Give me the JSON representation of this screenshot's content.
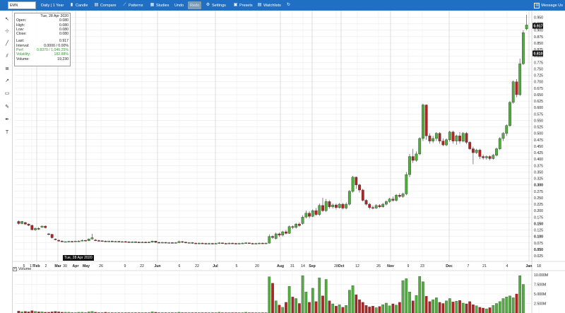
{
  "symbol": "EMN",
  "toolbar": {
    "timeframe": "Daily | 1 Year",
    "candle": "Candle",
    "compare": "Compare",
    "patterns": "Patterns",
    "studies": "Studies",
    "undo": "Undo",
    "redo": "Redo",
    "settings": "Settings",
    "presets": "Presets",
    "watchlists": "Watchlists",
    "message": "Message Us"
  },
  "colors": {
    "toolbar": "#1f6fc4",
    "up": "#4fae3c",
    "down": "#b22323",
    "grid": "#e6e6e6",
    "panel_green": "#2e9d2e"
  },
  "info_panel": {
    "date": "Tue, 28 Apr 2020",
    "open_label": "Open:",
    "open": "0.080",
    "high_label": "High:",
    "high": "0.080",
    "low_label": "Low:",
    "low": "0.080",
    "close_label": "Close:",
    "close": "0.080",
    "last_label": "Last:",
    "last": "0.917",
    "interval_label": "Interval:",
    "interval": "0.0000 / 0.00%",
    "perf_label": "Perf:",
    "perf": "0.8370 / 1,046.25%",
    "volatility_label": "Volatility:",
    "volatility": "182.88%",
    "volume_label": "Volume:",
    "volume": "19,230"
  },
  "cursor_date": "Tue, 28 Apr 2020",
  "volume_panel": {
    "label": "Volume"
  },
  "chart_data": {
    "type": "candlestick",
    "symbol": "EMN",
    "range": "Daily | 1 Year",
    "ylim": [
      0.025,
      0.965
    ],
    "y_ticks": [
      "0.950",
      "0.925",
      "0.900",
      "0.875",
      "0.850",
      "0.825",
      "0.800",
      "0.775",
      "0.750",
      "0.725",
      "0.700",
      "0.675",
      "0.650",
      "0.625",
      "0.600",
      "0.575",
      "0.550",
      "0.525",
      "0.500",
      "0.475",
      "0.450",
      "0.425",
      "0.400",
      "0.375",
      "0.350",
      "0.325",
      "0.300",
      "0.275",
      "0.250",
      "0.225",
      "0.200",
      "0.175",
      "0.150",
      "0.125",
      "0.100",
      "0.075",
      "0.050",
      "0.025"
    ],
    "bold_ticks": [
      "0.300",
      "0.150",
      "0.100",
      "0.050"
    ],
    "price_markers": [
      "0.917",
      "0.810"
    ],
    "x_ticks": [
      "5",
      "17",
      "Feb",
      "2",
      "Mar",
      "30",
      "Apr",
      "May",
      "26",
      "9",
      "22",
      "Jun",
      "6",
      "22",
      "Jul",
      "5",
      "20",
      "Aug",
      "31",
      "14",
      "Sep",
      "28",
      "Oct",
      "12",
      "26",
      "Nov",
      "9",
      "23",
      "Dec",
      "7",
      "21",
      "4",
      "Jan",
      "18"
    ],
    "volume_ticks": [
      "10.000M",
      "7.500M",
      "5.000M",
      "2.500M"
    ],
    "volume_ylim": [
      0,
      10
    ],
    "candles": [
      {
        "o": 0.158,
        "c": 0.15,
        "h": 0.162,
        "l": 0.146
      },
      {
        "o": 0.15,
        "c": 0.158,
        "h": 0.16,
        "l": 0.147
      },
      {
        "o": 0.154,
        "c": 0.148,
        "h": 0.156,
        "l": 0.145
      },
      {
        "o": 0.148,
        "c": 0.143,
        "h": 0.15,
        "l": 0.14
      },
      {
        "o": 0.143,
        "c": 0.126,
        "h": 0.145,
        "l": 0.124
      },
      {
        "o": 0.126,
        "c": 0.131,
        "h": 0.134,
        "l": 0.122
      },
      {
        "o": 0.131,
        "c": 0.128,
        "h": 0.136,
        "l": 0.125
      },
      {
        "o": 0.136,
        "c": 0.14,
        "h": 0.142,
        "l": 0.133
      },
      {
        "o": 0.14,
        "c": 0.134,
        "h": 0.142,
        "l": 0.131
      },
      {
        "o": 0.11,
        "c": 0.108,
        "h": 0.113,
        "l": 0.105
      },
      {
        "o": 0.108,
        "c": 0.095,
        "h": 0.11,
        "l": 0.092
      },
      {
        "o": 0.09,
        "c": 0.088,
        "h": 0.092,
        "l": 0.085
      },
      {
        "o": 0.085,
        "c": 0.082,
        "h": 0.088,
        "l": 0.08
      },
      {
        "o": 0.082,
        "c": 0.08,
        "h": 0.085,
        "l": 0.078
      },
      {
        "o": 0.08,
        "c": 0.08,
        "h": 0.08,
        "l": 0.08
      },
      {
        "o": 0.08,
        "c": 0.081,
        "h": 0.083,
        "l": 0.078
      },
      {
        "o": 0.081,
        "c": 0.08,
        "h": 0.083,
        "l": 0.078
      },
      {
        "o": 0.08,
        "c": 0.082,
        "h": 0.084,
        "l": 0.079
      },
      {
        "o": 0.082,
        "c": 0.082,
        "h": 0.085,
        "l": 0.08
      },
      {
        "o": 0.082,
        "c": 0.085,
        "h": 0.088,
        "l": 0.081
      },
      {
        "o": 0.085,
        "c": 0.083,
        "h": 0.086,
        "l": 0.08
      },
      {
        "o": 0.083,
        "c": 0.09,
        "h": 0.092,
        "l": 0.082
      },
      {
        "o": 0.09,
        "c": 0.095,
        "h": 0.11,
        "l": 0.088
      },
      {
        "o": 0.086,
        "c": 0.084,
        "h": 0.09,
        "l": 0.082
      },
      {
        "o": 0.084,
        "c": 0.083,
        "h": 0.087,
        "l": 0.081
      },
      {
        "o": 0.083,
        "c": 0.082,
        "h": 0.085,
        "l": 0.08
      },
      {
        "o": 0.082,
        "c": 0.081,
        "h": 0.084,
        "l": 0.079
      },
      {
        "o": 0.081,
        "c": 0.082,
        "h": 0.084,
        "l": 0.079
      },
      {
        "o": 0.082,
        "c": 0.08,
        "h": 0.084,
        "l": 0.078
      },
      {
        "o": 0.08,
        "c": 0.081,
        "h": 0.083,
        "l": 0.078
      },
      {
        "o": 0.081,
        "c": 0.079,
        "h": 0.083,
        "l": 0.077
      },
      {
        "o": 0.079,
        "c": 0.08,
        "h": 0.082,
        "l": 0.077
      },
      {
        "o": 0.08,
        "c": 0.079,
        "h": 0.082,
        "l": 0.077
      },
      {
        "o": 0.079,
        "c": 0.078,
        "h": 0.081,
        "l": 0.076
      },
      {
        "o": 0.078,
        "c": 0.079,
        "h": 0.081,
        "l": 0.076
      },
      {
        "o": 0.079,
        "c": 0.078,
        "h": 0.081,
        "l": 0.076
      },
      {
        "o": 0.078,
        "c": 0.077,
        "h": 0.08,
        "l": 0.075
      },
      {
        "o": 0.077,
        "c": 0.078,
        "h": 0.08,
        "l": 0.075
      },
      {
        "o": 0.078,
        "c": 0.077,
        "h": 0.08,
        "l": 0.075
      },
      {
        "o": 0.077,
        "c": 0.078,
        "h": 0.08,
        "l": 0.075
      },
      {
        "o": 0.078,
        "c": 0.082,
        "h": 0.084,
        "l": 0.076
      },
      {
        "o": 0.082,
        "c": 0.077,
        "h": 0.083,
        "l": 0.075
      },
      {
        "o": 0.077,
        "c": 0.076,
        "h": 0.079,
        "l": 0.074
      },
      {
        "o": 0.076,
        "c": 0.077,
        "h": 0.079,
        "l": 0.074
      },
      {
        "o": 0.077,
        "c": 0.075,
        "h": 0.078,
        "l": 0.073
      },
      {
        "o": 0.075,
        "c": 0.076,
        "h": 0.078,
        "l": 0.073
      },
      {
        "o": 0.076,
        "c": 0.075,
        "h": 0.078,
        "l": 0.073
      },
      {
        "o": 0.075,
        "c": 0.076,
        "h": 0.078,
        "l": 0.073
      },
      {
        "o": 0.076,
        "c": 0.08,
        "h": 0.084,
        "l": 0.074
      },
      {
        "o": 0.08,
        "c": 0.078,
        "h": 0.082,
        "l": 0.075
      },
      {
        "o": 0.078,
        "c": 0.075,
        "h": 0.079,
        "l": 0.073
      },
      {
        "o": 0.075,
        "c": 0.076,
        "h": 0.078,
        "l": 0.073
      },
      {
        "o": 0.076,
        "c": 0.074,
        "h": 0.078,
        "l": 0.072
      },
      {
        "o": 0.074,
        "c": 0.073,
        "h": 0.076,
        "l": 0.071
      },
      {
        "o": 0.073,
        "c": 0.074,
        "h": 0.076,
        "l": 0.071
      },
      {
        "o": 0.074,
        "c": 0.073,
        "h": 0.076,
        "l": 0.071
      },
      {
        "o": 0.073,
        "c": 0.072,
        "h": 0.075,
        "l": 0.07
      },
      {
        "o": 0.072,
        "c": 0.073,
        "h": 0.075,
        "l": 0.07
      },
      {
        "o": 0.073,
        "c": 0.072,
        "h": 0.075,
        "l": 0.07
      },
      {
        "o": 0.072,
        "c": 0.073,
        "h": 0.075,
        "l": 0.07
      },
      {
        "o": 0.073,
        "c": 0.075,
        "h": 0.078,
        "l": 0.071
      },
      {
        "o": 0.075,
        "c": 0.073,
        "h": 0.076,
        "l": 0.071
      },
      {
        "o": 0.073,
        "c": 0.072,
        "h": 0.075,
        "l": 0.07
      },
      {
        "o": 0.072,
        "c": 0.074,
        "h": 0.076,
        "l": 0.07
      },
      {
        "o": 0.074,
        "c": 0.073,
        "h": 0.076,
        "l": 0.071
      },
      {
        "o": 0.073,
        "c": 0.072,
        "h": 0.075,
        "l": 0.07
      },
      {
        "o": 0.072,
        "c": 0.073,
        "h": 0.075,
        "l": 0.07
      },
      {
        "o": 0.073,
        "c": 0.074,
        "h": 0.076,
        "l": 0.071
      },
      {
        "o": 0.074,
        "c": 0.075,
        "h": 0.078,
        "l": 0.072
      },
      {
        "o": 0.075,
        "c": 0.073,
        "h": 0.076,
        "l": 0.071
      },
      {
        "o": 0.073,
        "c": 0.072,
        "h": 0.075,
        "l": 0.07
      },
      {
        "o": 0.072,
        "c": 0.073,
        "h": 0.075,
        "l": 0.07
      },
      {
        "o": 0.073,
        "c": 0.074,
        "h": 0.076,
        "l": 0.071
      },
      {
        "o": 0.074,
        "c": 0.073,
        "h": 0.076,
        "l": 0.071
      },
      {
        "o": 0.073,
        "c": 0.074,
        "h": 0.076,
        "l": 0.071
      },
      {
        "o": 0.074,
        "c": 0.1,
        "h": 0.108,
        "l": 0.072
      },
      {
        "o": 0.1,
        "c": 0.096,
        "h": 0.105,
        "l": 0.09
      },
      {
        "o": 0.092,
        "c": 0.11,
        "h": 0.115,
        "l": 0.088
      },
      {
        "o": 0.11,
        "c": 0.105,
        "h": 0.115,
        "l": 0.098
      },
      {
        "o": 0.105,
        "c": 0.118,
        "h": 0.122,
        "l": 0.1
      },
      {
        "o": 0.118,
        "c": 0.112,
        "h": 0.125,
        "l": 0.108
      },
      {
        "o": 0.112,
        "c": 0.138,
        "h": 0.142,
        "l": 0.11
      },
      {
        "o": 0.138,
        "c": 0.135,
        "h": 0.143,
        "l": 0.128
      },
      {
        "o": 0.135,
        "c": 0.148,
        "h": 0.152,
        "l": 0.13
      },
      {
        "o": 0.148,
        "c": 0.142,
        "h": 0.155,
        "l": 0.138
      },
      {
        "o": 0.15,
        "c": 0.175,
        "h": 0.182,
        "l": 0.146
      },
      {
        "o": 0.175,
        "c": 0.19,
        "h": 0.2,
        "l": 0.17
      },
      {
        "o": 0.19,
        "c": 0.178,
        "h": 0.198,
        "l": 0.17
      },
      {
        "o": 0.178,
        "c": 0.2,
        "h": 0.205,
        "l": 0.175
      },
      {
        "o": 0.2,
        "c": 0.185,
        "h": 0.21,
        "l": 0.18
      },
      {
        "o": 0.185,
        "c": 0.22,
        "h": 0.228,
        "l": 0.18
      },
      {
        "o": 0.22,
        "c": 0.2,
        "h": 0.25,
        "l": 0.195
      },
      {
        "o": 0.2,
        "c": 0.235,
        "h": 0.245,
        "l": 0.195
      },
      {
        "o": 0.235,
        "c": 0.215,
        "h": 0.24,
        "l": 0.208
      },
      {
        "o": 0.215,
        "c": 0.222,
        "h": 0.228,
        "l": 0.208
      },
      {
        "o": 0.222,
        "c": 0.212,
        "h": 0.228,
        "l": 0.205
      },
      {
        "o": 0.212,
        "c": 0.225,
        "h": 0.23,
        "l": 0.208
      },
      {
        "o": 0.225,
        "c": 0.21,
        "h": 0.23,
        "l": 0.205
      },
      {
        "o": 0.21,
        "c": 0.225,
        "h": 0.232,
        "l": 0.205
      },
      {
        "o": 0.225,
        "c": 0.275,
        "h": 0.28,
        "l": 0.22
      },
      {
        "o": 0.275,
        "c": 0.33,
        "h": 0.335,
        "l": 0.27
      },
      {
        "o": 0.33,
        "c": 0.3,
        "h": 0.332,
        "l": 0.285
      },
      {
        "o": 0.3,
        "c": 0.28,
        "h": 0.305,
        "l": 0.27
      },
      {
        "o": 0.28,
        "c": 0.24,
        "h": 0.285,
        "l": 0.235
      },
      {
        "o": 0.24,
        "c": 0.225,
        "h": 0.245,
        "l": 0.22
      },
      {
        "o": 0.225,
        "c": 0.212,
        "h": 0.23,
        "l": 0.205
      },
      {
        "o": 0.212,
        "c": 0.21,
        "h": 0.22,
        "l": 0.205
      },
      {
        "o": 0.21,
        "c": 0.22,
        "h": 0.225,
        "l": 0.207
      },
      {
        "o": 0.22,
        "c": 0.215,
        "h": 0.225,
        "l": 0.21
      },
      {
        "o": 0.215,
        "c": 0.225,
        "h": 0.23,
        "l": 0.212
      },
      {
        "o": 0.225,
        "c": 0.235,
        "h": 0.24,
        "l": 0.22
      },
      {
        "o": 0.235,
        "c": 0.245,
        "h": 0.25,
        "l": 0.23
      },
      {
        "o": 0.245,
        "c": 0.24,
        "h": 0.255,
        "l": 0.235
      },
      {
        "o": 0.24,
        "c": 0.26,
        "h": 0.265,
        "l": 0.235
      },
      {
        "o": 0.26,
        "c": 0.255,
        "h": 0.268,
        "l": 0.25
      },
      {
        "o": 0.255,
        "c": 0.265,
        "h": 0.27,
        "l": 0.25
      },
      {
        "o": 0.265,
        "c": 0.34,
        "h": 0.35,
        "l": 0.26
      },
      {
        "o": 0.34,
        "c": 0.41,
        "h": 0.42,
        "l": 0.33
      },
      {
        "o": 0.41,
        "c": 0.395,
        "h": 0.44,
        "l": 0.385
      },
      {
        "o": 0.395,
        "c": 0.42,
        "h": 0.43,
        "l": 0.39
      },
      {
        "o": 0.42,
        "c": 0.48,
        "h": 0.485,
        "l": 0.415
      },
      {
        "o": 0.48,
        "c": 0.61,
        "h": 0.615,
        "l": 0.47
      },
      {
        "o": 0.61,
        "c": 0.49,
        "h": 0.612,
        "l": 0.475
      },
      {
        "o": 0.49,
        "c": 0.47,
        "h": 0.5,
        "l": 0.46
      },
      {
        "o": 0.47,
        "c": 0.48,
        "h": 0.49,
        "l": 0.462
      },
      {
        "o": 0.48,
        "c": 0.5,
        "h": 0.505,
        "l": 0.47
      },
      {
        "o": 0.5,
        "c": 0.47,
        "h": 0.505,
        "l": 0.46
      },
      {
        "o": 0.47,
        "c": 0.455,
        "h": 0.48,
        "l": 0.45
      },
      {
        "o": 0.455,
        "c": 0.475,
        "h": 0.48,
        "l": 0.45
      },
      {
        "o": 0.475,
        "c": 0.505,
        "h": 0.51,
        "l": 0.468
      },
      {
        "o": 0.505,
        "c": 0.47,
        "h": 0.51,
        "l": 0.46
      },
      {
        "o": 0.47,
        "c": 0.49,
        "h": 0.495,
        "l": 0.455
      },
      {
        "o": 0.49,
        "c": 0.47,
        "h": 0.505,
        "l": 0.46
      },
      {
        "o": 0.47,
        "c": 0.5,
        "h": 0.505,
        "l": 0.465
      },
      {
        "o": 0.5,
        "c": 0.465,
        "h": 0.505,
        "l": 0.458
      },
      {
        "o": 0.465,
        "c": 0.44,
        "h": 0.47,
        "l": 0.435
      },
      {
        "o": 0.44,
        "c": 0.425,
        "h": 0.448,
        "l": 0.38
      },
      {
        "o": 0.425,
        "c": 0.435,
        "h": 0.44,
        "l": 0.42
      },
      {
        "o": 0.435,
        "c": 0.41,
        "h": 0.44,
        "l": 0.4
      },
      {
        "o": 0.41,
        "c": 0.405,
        "h": 0.418,
        "l": 0.398
      },
      {
        "o": 0.405,
        "c": 0.41,
        "h": 0.415,
        "l": 0.398
      },
      {
        "o": 0.41,
        "c": 0.402,
        "h": 0.415,
        "l": 0.395
      },
      {
        "o": 0.402,
        "c": 0.415,
        "h": 0.42,
        "l": 0.398
      },
      {
        "o": 0.415,
        "c": 0.44,
        "h": 0.445,
        "l": 0.41
      },
      {
        "o": 0.44,
        "c": 0.48,
        "h": 0.485,
        "l": 0.435
      },
      {
        "o": 0.48,
        "c": 0.5,
        "h": 0.505,
        "l": 0.47
      },
      {
        "o": 0.5,
        "c": 0.53,
        "h": 0.535,
        "l": 0.49
      },
      {
        "o": 0.53,
        "c": 0.62,
        "h": 0.625,
        "l": 0.525
      },
      {
        "o": 0.62,
        "c": 0.7,
        "h": 0.705,
        "l": 0.615
      },
      {
        "o": 0.7,
        "c": 0.65,
        "h": 0.71,
        "l": 0.64
      },
      {
        "o": 0.65,
        "c": 0.77,
        "h": 0.79,
        "l": 0.645
      },
      {
        "o": 0.77,
        "c": 0.89,
        "h": 0.9,
        "l": 0.765
      },
      {
        "o": 0.905,
        "c": 0.92,
        "h": 0.96,
        "l": 0.9
      }
    ],
    "volume": [
      0.5,
      0.3,
      0.4,
      0.3,
      0.6,
      0.4,
      0.3,
      0.3,
      0.2,
      0.2,
      0.3,
      0.4,
      0.3,
      0.2,
      0.2,
      0.2,
      0.1,
      0.1,
      0.2,
      0.2,
      0.1,
      0.3,
      0.4,
      0.2,
      0.1,
      0.1,
      0.2,
      0.1,
      0.1,
      0.1,
      0.1,
      0.1,
      0.1,
      0.1,
      0.1,
      0.1,
      0.1,
      0.1,
      0.1,
      0.1,
      0.3,
      0.2,
      0.1,
      0.1,
      0.1,
      0.1,
      0.1,
      0.1,
      0.2,
      0.1,
      0.1,
      0.1,
      0.1,
      0.1,
      0.1,
      0.1,
      0.1,
      0.1,
      0.1,
      0.1,
      0.2,
      0.1,
      0.1,
      0.1,
      0.1,
      0.1,
      0.1,
      0.1,
      0.2,
      0.1,
      0.1,
      0.1,
      0.1,
      0.1,
      0.1,
      9.5,
      7.8,
      3.2,
      2.1,
      1.5,
      2.8,
      7.0,
      4.2,
      3.8,
      2.5,
      9.8,
      5.5,
      2.8,
      6.5,
      3.0,
      9.2,
      4.5,
      8.8,
      3.2,
      2.4,
      1.8,
      2.2,
      1.5,
      2.0,
      6.0,
      7.2,
      4.8,
      3.5,
      2.8,
      2.0,
      1.6,
      1.8,
      1.4,
      1.7,
      2.2,
      2.6,
      1.9,
      2.4,
      2.1,
      2.8,
      8.5,
      9.0,
      5.5,
      3.2,
      4.6,
      9.6,
      8.2,
      4.4,
      3.0,
      3.5,
      4.0,
      2.8,
      2.5,
      3.2,
      3.8,
      2.9,
      3.1,
      3.3,
      2.6,
      2.4,
      3.0,
      2.2,
      1.9,
      1.5,
      1.3,
      1.1,
      1.4,
      2.0,
      2.5,
      3.0,
      3.8,
      4.2,
      4.5,
      4.0,
      5.0,
      9.8,
      7.5
    ]
  }
}
